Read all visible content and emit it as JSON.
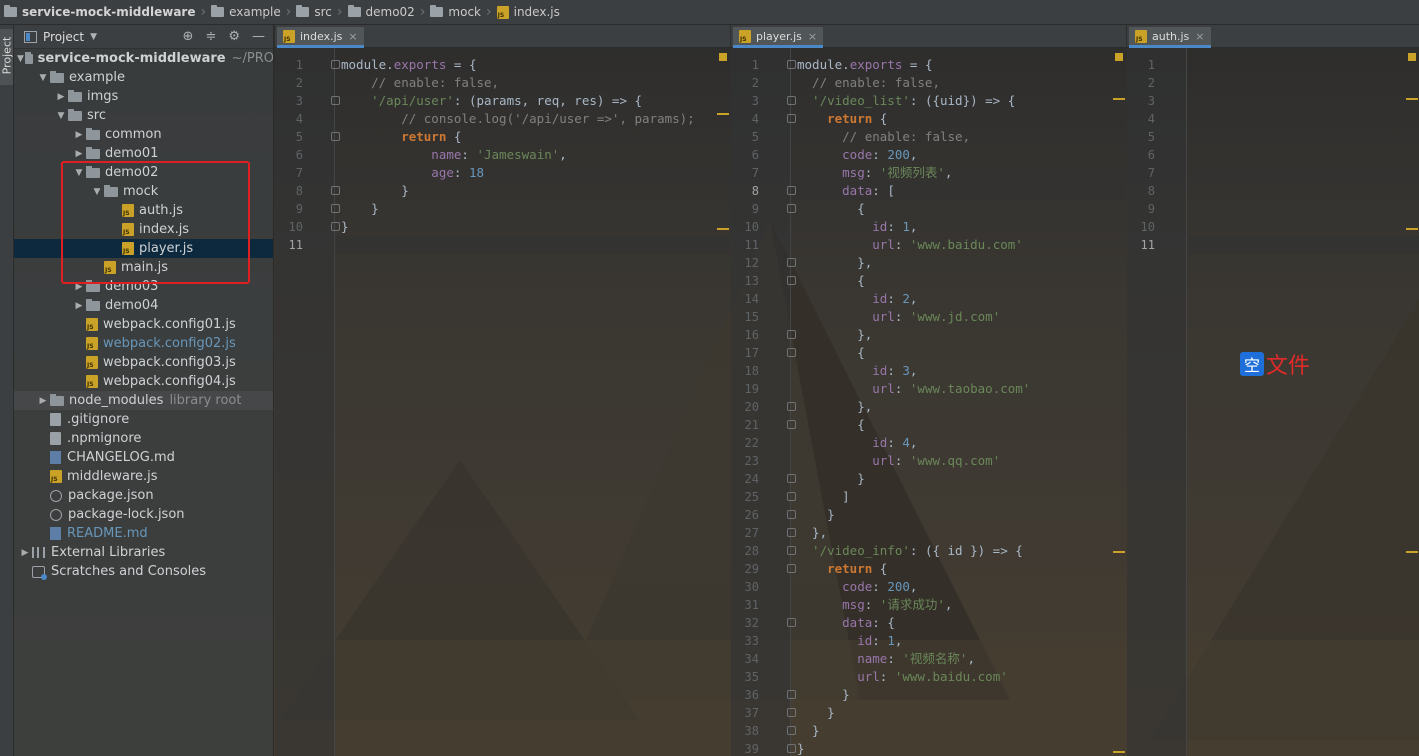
{
  "breadcrumb": {
    "items": [
      "service-mock-middleware",
      "example",
      "src",
      "demo02",
      "mock",
      "index.js"
    ]
  },
  "left_strip": {
    "tab_label": "Project"
  },
  "project": {
    "header_label": "Project",
    "tree": [
      {
        "label": "service-mock-middleware",
        "extra": "~/PRO",
        "arrow": "▼",
        "icon": "folder-icon",
        "depth": 0,
        "bold": true
      },
      {
        "label": "example",
        "arrow": "▼",
        "icon": "folder-icon",
        "depth": 1
      },
      {
        "label": "imgs",
        "arrow": "▶",
        "icon": "folder-icon",
        "depth": 2
      },
      {
        "label": "src",
        "arrow": "▼",
        "icon": "folder-icon",
        "depth": 2
      },
      {
        "label": "common",
        "arrow": "▶",
        "icon": "folder-icon",
        "depth": 3
      },
      {
        "label": "demo01",
        "arrow": "▶",
        "icon": "folder-icon",
        "depth": 3
      },
      {
        "label": "demo02",
        "arrow": "▼",
        "icon": "folder-icon",
        "depth": 3
      },
      {
        "label": "mock",
        "arrow": "▼",
        "icon": "folder-icon",
        "depth": 4
      },
      {
        "label": "auth.js",
        "icon": "binary-js-icon",
        "depth": 5
      },
      {
        "label": "index.js",
        "icon": "js-file-icon",
        "depth": 5
      },
      {
        "label": "player.js",
        "icon": "js-file-icon",
        "depth": 5,
        "selected": true
      },
      {
        "label": "main.js",
        "icon": "js-file-icon",
        "depth": 4
      },
      {
        "label": "demo03",
        "arrow": "▶",
        "icon": "folder-icon",
        "depth": 3
      },
      {
        "label": "demo04",
        "arrow": "▶",
        "icon": "folder-icon",
        "depth": 3
      },
      {
        "label": "webpack.config01.js",
        "icon": "js-file-icon",
        "depth": 3
      },
      {
        "label": "webpack.config02.js",
        "icon": "js-file-icon",
        "depth": 3,
        "blue": true
      },
      {
        "label": "webpack.config03.js",
        "icon": "js-file-icon",
        "depth": 3
      },
      {
        "label": "webpack.config04.js",
        "icon": "js-file-icon",
        "depth": 3
      },
      {
        "label": "node_modules",
        "extra": "library root",
        "arrow": "▶",
        "icon": "folder-icon",
        "depth": 1,
        "highlight": true
      },
      {
        "label": ".gitignore",
        "icon": "text-file-icon",
        "depth": 1
      },
      {
        "label": ".npmignore",
        "icon": "text-file-icon",
        "depth": 1
      },
      {
        "label": "CHANGELOG.md",
        "icon": "markdown-icon",
        "depth": 1
      },
      {
        "label": "middleware.js",
        "icon": "js-file-icon",
        "depth": 1
      },
      {
        "label": "package.json",
        "icon": "package-json-icon",
        "depth": 1
      },
      {
        "label": "package-lock.json",
        "icon": "package-json-icon",
        "depth": 1
      },
      {
        "label": "README.md",
        "icon": "markdown-icon",
        "depth": 1,
        "blue": true
      },
      {
        "label": "External Libraries",
        "arrow": "▶",
        "icon": "library-icon",
        "depth": 0
      },
      {
        "label": "Scratches and Consoles",
        "icon": "scratches-icon",
        "depth": 0
      }
    ]
  },
  "editors": {
    "index": {
      "tab_label": "index.js",
      "close": "×",
      "lines": [
        [
          [
            "plain",
            "module."
          ],
          [
            "prop",
            "exports"
          ],
          [
            "plain",
            " = {"
          ]
        ],
        [
          [
            "cm",
            "    // enable: false,"
          ]
        ],
        [
          [
            "str",
            "    '/api/user'"
          ],
          [
            "plain",
            ": (params, req, res) => {"
          ]
        ],
        [
          [
            "cm",
            "        // console.log('/api/user =>', params);"
          ]
        ],
        [
          [
            "kw",
            "        return"
          ],
          [
            "plain",
            " {"
          ]
        ],
        [
          [
            "prop",
            "            name"
          ],
          [
            "plain",
            ": "
          ],
          [
            "str",
            "'Jameswain'"
          ],
          [
            "plain",
            ","
          ]
        ],
        [
          [
            "prop",
            "            age"
          ],
          [
            "plain",
            ": "
          ],
          [
            "num",
            "18"
          ]
        ],
        [
          [
            "plain",
            "        }"
          ]
        ],
        [
          [
            "plain",
            "    }"
          ]
        ],
        [
          [
            "plain",
            "}"
          ]
        ],
        [
          [
            "plain",
            ""
          ]
        ]
      ]
    },
    "player": {
      "tab_label": "player.js",
      "close": "×",
      "lines": [
        [
          [
            "plain",
            "module."
          ],
          [
            "prop",
            "exports"
          ],
          [
            "plain",
            " = {"
          ]
        ],
        [
          [
            "cm",
            "  // enable: false,"
          ]
        ],
        [
          [
            "str",
            "  '/video_list'"
          ],
          [
            "plain",
            ": ({uid}) => {"
          ]
        ],
        [
          [
            "kw",
            "    return"
          ],
          [
            "plain",
            " {"
          ]
        ],
        [
          [
            "cm",
            "      // enable: false,"
          ]
        ],
        [
          [
            "prop",
            "      code"
          ],
          [
            "plain",
            ": "
          ],
          [
            "num",
            "200"
          ],
          [
            "plain",
            ","
          ]
        ],
        [
          [
            "prop",
            "      msg"
          ],
          [
            "plain",
            ": "
          ],
          [
            "str",
            "'视频列表'"
          ],
          [
            "plain",
            ","
          ]
        ],
        [
          [
            "prop",
            "      data"
          ],
          [
            "plain",
            ": ["
          ]
        ],
        [
          [
            "plain",
            "        {"
          ]
        ],
        [
          [
            "prop",
            "          id"
          ],
          [
            "plain",
            ": "
          ],
          [
            "num",
            "1"
          ],
          [
            "plain",
            ","
          ]
        ],
        [
          [
            "prop",
            "          url"
          ],
          [
            "plain",
            ": "
          ],
          [
            "str",
            "'www.baidu.com'"
          ]
        ],
        [
          [
            "plain",
            "        },"
          ]
        ],
        [
          [
            "plain",
            "        {"
          ]
        ],
        [
          [
            "prop",
            "          id"
          ],
          [
            "plain",
            ": "
          ],
          [
            "num",
            "2"
          ],
          [
            "plain",
            ","
          ]
        ],
        [
          [
            "prop",
            "          url"
          ],
          [
            "plain",
            ": "
          ],
          [
            "str",
            "'www.jd.com'"
          ]
        ],
        [
          [
            "plain",
            "        },"
          ]
        ],
        [
          [
            "plain",
            "        {"
          ]
        ],
        [
          [
            "prop",
            "          id"
          ],
          [
            "plain",
            ": "
          ],
          [
            "num",
            "3"
          ],
          [
            "plain",
            ","
          ]
        ],
        [
          [
            "prop",
            "          url"
          ],
          [
            "plain",
            ": "
          ],
          [
            "str",
            "'www.taobao.com'"
          ]
        ],
        [
          [
            "plain",
            "        },"
          ]
        ],
        [
          [
            "plain",
            "        {"
          ]
        ],
        [
          [
            "prop",
            "          id"
          ],
          [
            "plain",
            ": "
          ],
          [
            "num",
            "4"
          ],
          [
            "plain",
            ","
          ]
        ],
        [
          [
            "prop",
            "          url"
          ],
          [
            "plain",
            ": "
          ],
          [
            "str",
            "'www.qq.com'"
          ]
        ],
        [
          [
            "plain",
            "        }"
          ]
        ],
        [
          [
            "plain",
            "      ]"
          ]
        ],
        [
          [
            "plain",
            "    }"
          ]
        ],
        [
          [
            "plain",
            "  },"
          ]
        ],
        [
          [
            "str",
            "  '/video_info'"
          ],
          [
            "plain",
            ": ({ id }) => {"
          ]
        ],
        [
          [
            "kw",
            "    return"
          ],
          [
            "plain",
            " {"
          ]
        ],
        [
          [
            "prop",
            "      code"
          ],
          [
            "plain",
            ": "
          ],
          [
            "num",
            "200"
          ],
          [
            "plain",
            ","
          ]
        ],
        [
          [
            "prop",
            "      msg"
          ],
          [
            "plain",
            ": "
          ],
          [
            "str",
            "'请求成功'"
          ],
          [
            "plain",
            ","
          ]
        ],
        [
          [
            "prop",
            "      data"
          ],
          [
            "plain",
            ": {"
          ]
        ],
        [
          [
            "prop",
            "        id"
          ],
          [
            "plain",
            ": "
          ],
          [
            "num",
            "1"
          ],
          [
            "plain",
            ","
          ]
        ],
        [
          [
            "prop",
            "        name"
          ],
          [
            "plain",
            ": "
          ],
          [
            "str",
            "'视频名称'"
          ],
          [
            "plain",
            ","
          ]
        ],
        [
          [
            "prop",
            "        url"
          ],
          [
            "plain",
            ": "
          ],
          [
            "str",
            "'www.baidu.com'"
          ]
        ],
        [
          [
            "plain",
            "      }"
          ]
        ],
        [
          [
            "plain",
            "    }"
          ]
        ],
        [
          [
            "plain",
            "  }"
          ]
        ],
        [
          [
            "plain",
            "}"
          ]
        ]
      ]
    },
    "auth": {
      "tab_label": "auth.js",
      "close": "×",
      "line_count": 11,
      "empty_badge": "空",
      "empty_text": "文件"
    }
  }
}
